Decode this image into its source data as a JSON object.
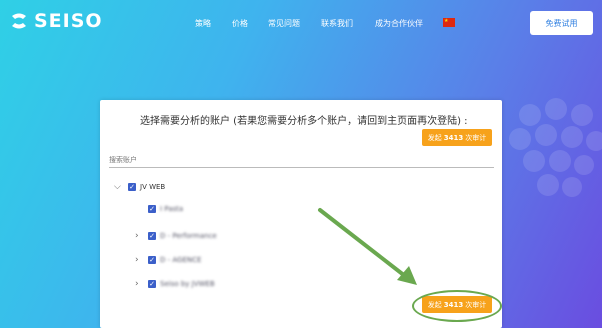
{
  "brand": {
    "name": "SEISO"
  },
  "nav": {
    "items": [
      {
        "label": "策略",
        "name": "nav-strategy"
      },
      {
        "label": "价格",
        "name": "nav-pricing"
      },
      {
        "label": "常见问题",
        "name": "nav-faq"
      },
      {
        "label": "联系我们",
        "name": "nav-contact"
      },
      {
        "label": "成为合作伙伴",
        "name": "nav-partner"
      }
    ],
    "trial_label": "免费试用"
  },
  "panel": {
    "title": "选择需要分析的账户 (若果您需要分析多个账户，请回到主页面再次登陆) :",
    "audit_button": {
      "prefix": "发起",
      "count": "3413",
      "suffix": "次审计"
    },
    "search_placeholder": "搜索账户",
    "tree": {
      "root": {
        "label": "JV WEB"
      },
      "children": [
        {
          "label": "I Pasta"
        },
        {
          "label": "D - Performance"
        },
        {
          "label": "D - AGENCE"
        },
        {
          "label": "Seiso by JVWEB"
        }
      ]
    }
  },
  "colors": {
    "accent": "#f7a21b",
    "checkbox": "#3b5fc9",
    "annotation": "#6aa84f"
  }
}
